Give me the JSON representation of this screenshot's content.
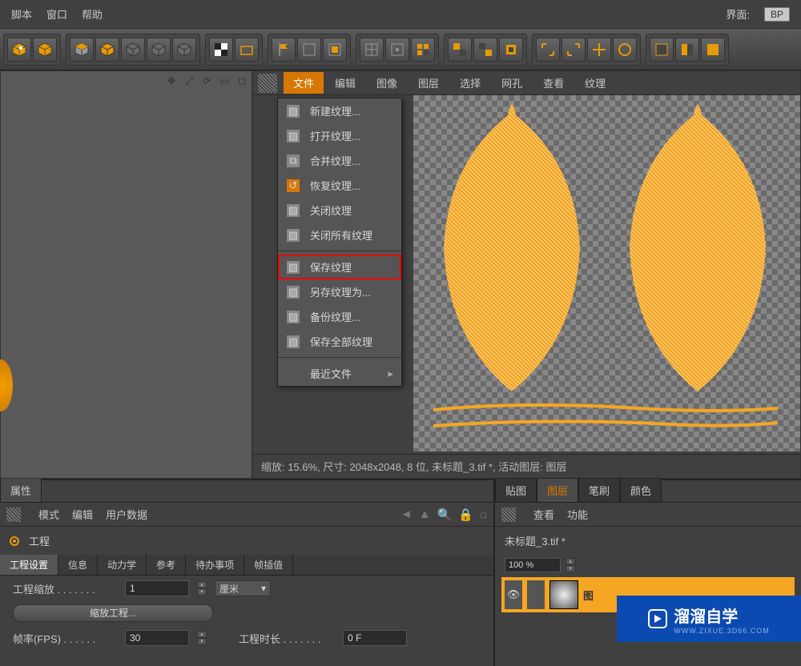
{
  "top_menu": {
    "items": [
      "脚本",
      "窗口",
      "帮助"
    ],
    "right_label": "界面:",
    "bp": "BP"
  },
  "texture_menu": {
    "items": [
      "文件",
      "编辑",
      "图像",
      "图层",
      "选择",
      "网孔",
      "查看",
      "纹理"
    ],
    "active_index": 0
  },
  "file_dropdown": {
    "items": [
      {
        "label": "新建纹理...",
        "icon": "new"
      },
      {
        "label": "打开纹理...",
        "icon": "open"
      },
      {
        "label": "合并纹理...",
        "icon": "merge"
      },
      {
        "label": "恢复纹理...",
        "icon": "restore"
      },
      {
        "label": "关闭纹理",
        "icon": "close"
      },
      {
        "label": "关闭所有纹理",
        "icon": "closeall"
      },
      {
        "sep": true
      },
      {
        "label": "保存纹理",
        "icon": "save",
        "highlight": true
      },
      {
        "label": "另存纹理为...",
        "icon": "saveas"
      },
      {
        "label": "备份纹理...",
        "icon": "backup"
      },
      {
        "label": "保存全部纹理",
        "icon": "saveall"
      },
      {
        "sep": true
      },
      {
        "label": "最近文件",
        "icon": "recent",
        "arrow": true
      }
    ]
  },
  "status": "缩放: 15.6%, 尺寸: 2048x2048, 8 位, 未标题_3.tif *, 活动图层: 图层",
  "bottom_left": {
    "panel_tab": "属性",
    "sub_menu": [
      "模式",
      "编辑",
      "用户数据"
    ],
    "project_label": "工程",
    "tabs": [
      "工程设置",
      "信息",
      "动力学",
      "参考",
      "待办事项",
      "帧插值"
    ],
    "active_tab_index": 0,
    "fields": {
      "scale_label": "工程缩放 . . . . . . .",
      "scale_value": "1",
      "scale_unit": "厘米",
      "scale_button": "缩放工程...",
      "fps_label": "帧率(FPS) . . . . . .",
      "fps_value": "30",
      "duration_label": "工程时长 . . . . . . .",
      "duration_value": "0 F"
    }
  },
  "bottom_right": {
    "tabs": [
      "贴图",
      "图层",
      "笔刷",
      "颜色"
    ],
    "active_tab_index": 1,
    "sub_menu": [
      "查看",
      "功能"
    ],
    "file": "未标题_3.tif *",
    "percent": "100 %",
    "layer_name": "图"
  },
  "watermark": {
    "brand": "溜溜自学",
    "sub": "WWW.ZIXUE.3D66.COM"
  },
  "colors": {
    "orange": "#f5a623",
    "orange2": "#d87800",
    "panel": "#404040"
  }
}
